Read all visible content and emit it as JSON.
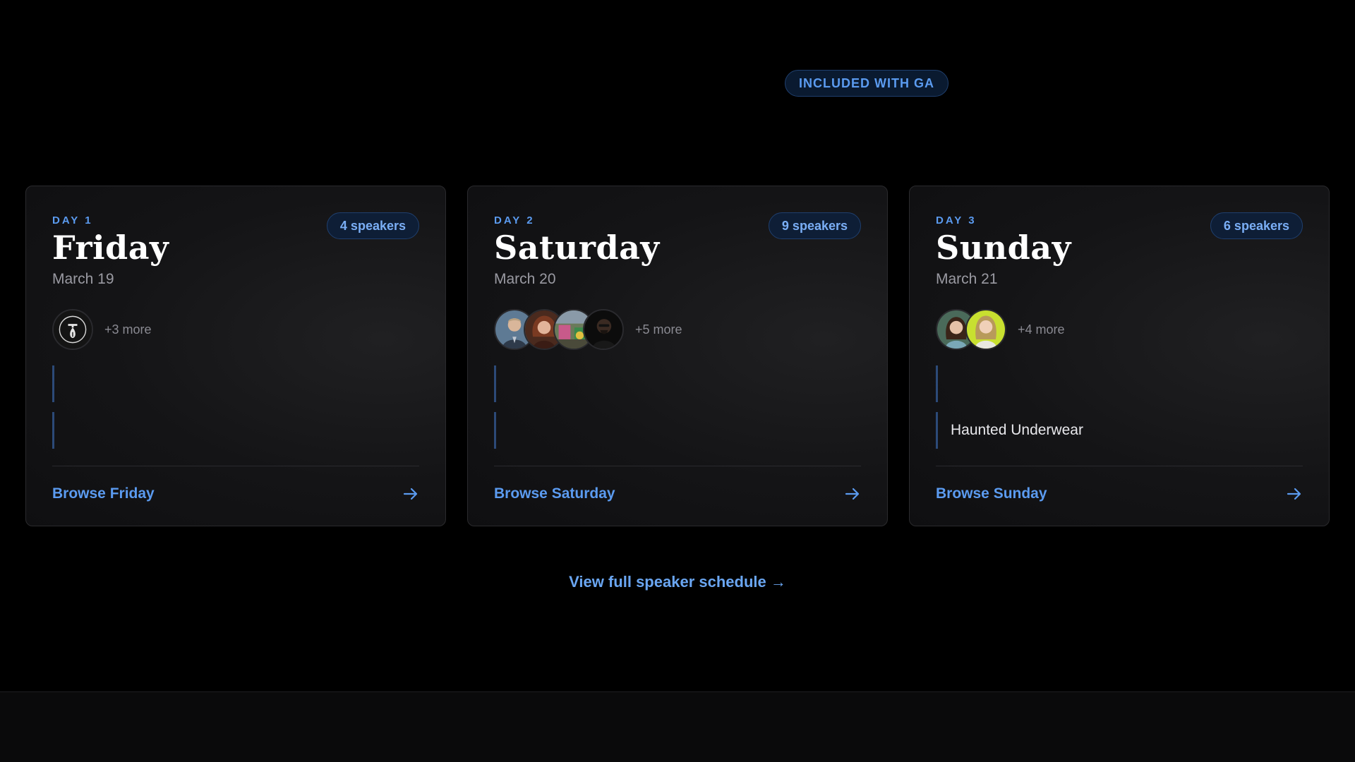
{
  "badge": {
    "label": "INCLUDED WITH GA"
  },
  "days": [
    {
      "day_label": "DAY 1",
      "name": "Friday",
      "date": "March 19",
      "speakers": "4 speakers",
      "more": "+3 more",
      "items": [
        "",
        ""
      ],
      "browse": "Browse Friday"
    },
    {
      "day_label": "DAY 2",
      "name": "Saturday",
      "date": "March 20",
      "speakers": "9 speakers",
      "more": "+5 more",
      "items": [
        "",
        ""
      ],
      "browse": "Browse Saturday"
    },
    {
      "day_label": "DAY 3",
      "name": "Sunday",
      "date": "March 21",
      "speakers": "6 speakers",
      "more": "+4 more",
      "items": [
        "",
        "Haunted Underwear"
      ],
      "browse": "Browse Sunday"
    }
  ],
  "full_schedule": {
    "label": "View full speaker schedule →"
  },
  "colors": {
    "accent": "#5b9bf0",
    "background": "#000000",
    "card": "#141416"
  },
  "icons": {
    "browse_arrow": "arrow-right-icon"
  }
}
